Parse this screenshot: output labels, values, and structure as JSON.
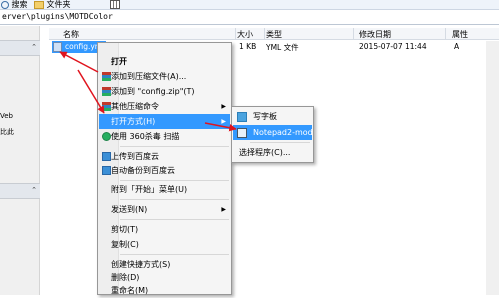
{
  "toolbar": {
    "search_label": "搜索",
    "new_folder_label": "文件夹"
  },
  "address": {
    "path": "erver\\plugins\\MOTDColor"
  },
  "nav": {
    "text_line1": "Veb",
    "text_line2": "比此"
  },
  "file_list": {
    "columns": [
      "名称",
      "大小",
      "类型",
      "修改日期",
      "属性"
    ],
    "rows": [
      {
        "name": "config.yml",
        "size": "1 KB",
        "type": "YML 文件",
        "modified": "2015-07-07 11:44",
        "attr": "A"
      }
    ]
  },
  "context_menu": {
    "items": [
      {
        "label": "打开",
        "bold": true
      },
      {
        "label": "添加到压缩文件(A)..."
      },
      {
        "label": "添加到 \"config.zip\"(T)"
      },
      {
        "label": "其他压缩命令"
      },
      {
        "label": "打开方式(H)"
      },
      {
        "label": "使用 360杀毒 扫描"
      },
      {
        "label": "上传到百度云"
      },
      {
        "label": "自动备份到百度云"
      },
      {
        "label": "附到「开始」菜单(U)"
      },
      {
        "label": "发送到(N)"
      },
      {
        "label": "剪切(T)"
      },
      {
        "label": "复制(C)"
      },
      {
        "label": "创建快捷方式(S)"
      },
      {
        "label": "删除(D)"
      },
      {
        "label": "重命名(M)"
      }
    ]
  },
  "open_with_submenu": {
    "items": [
      {
        "label": "写字板"
      },
      {
        "label": "Notepad2-mod"
      },
      {
        "label": "选择程序(C)..."
      }
    ]
  },
  "colors": {
    "highlight": "#3399ff",
    "annotation_arrow": "#e0141e"
  }
}
